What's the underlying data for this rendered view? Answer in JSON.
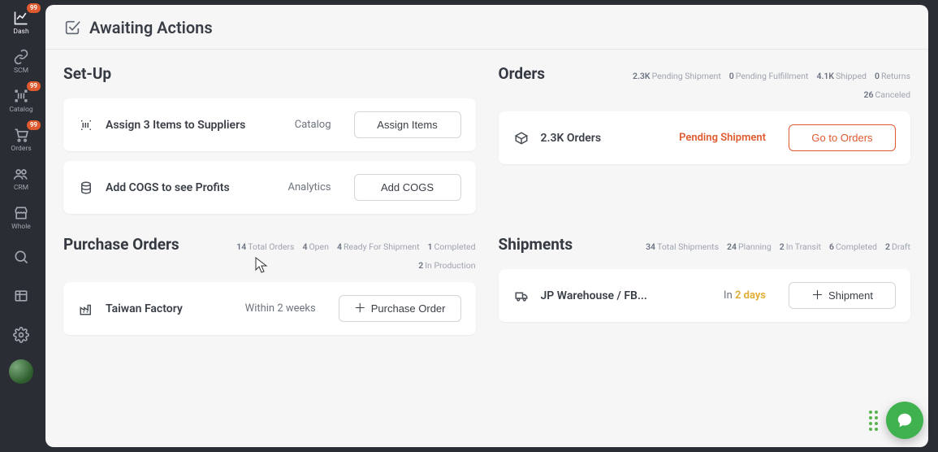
{
  "sidebar": {
    "items": [
      {
        "label": "Dash",
        "badge": "99"
      },
      {
        "label": "SCM",
        "badge": ""
      },
      {
        "label": "Catalog",
        "badge": "99"
      },
      {
        "label": "Orders",
        "badge": "99"
      },
      {
        "label": "CRM",
        "badge": ""
      },
      {
        "label": "Whole",
        "badge": ""
      }
    ]
  },
  "header": {
    "title": "Awaiting Actions"
  },
  "setup": {
    "title": "Set-Up",
    "cards": [
      {
        "title": "Assign 3 Items to Suppliers",
        "sub": "Catalog",
        "btn": "Assign Items"
      },
      {
        "title": "Add COGS to see Profits",
        "sub": "Analytics",
        "btn": "Add COGS"
      }
    ]
  },
  "orders": {
    "title": "Orders",
    "stats": [
      {
        "num": "2.3K",
        "label": "Pending Shipment"
      },
      {
        "num": "0",
        "label": "Pending Fulfillment"
      },
      {
        "num": "4.1K",
        "label": "Shipped"
      },
      {
        "num": "0",
        "label": "Returns"
      },
      {
        "num": "26",
        "label": "Canceled"
      }
    ],
    "card": {
      "title": "2.3K Orders",
      "status": "Pending Shipment",
      "btn": "Go to Orders"
    }
  },
  "po": {
    "title": "Purchase Orders",
    "stats": [
      {
        "num": "14",
        "label": "Total Orders"
      },
      {
        "num": "4",
        "label": "Open"
      },
      {
        "num": "4",
        "label": "Ready For Shipment"
      },
      {
        "num": "1",
        "label": "Completed"
      },
      {
        "num": "2",
        "label": "In Production"
      }
    ],
    "card": {
      "title": "Taiwan Factory",
      "sub": "Within 2 weeks",
      "btn": "Purchase Order"
    }
  },
  "shipments": {
    "title": "Shipments",
    "stats": [
      {
        "num": "34",
        "label": "Total Shipments"
      },
      {
        "num": "24",
        "label": "Planning"
      },
      {
        "num": "2",
        "label": "In Transit"
      },
      {
        "num": "6",
        "label": "Completed"
      },
      {
        "num": "2",
        "label": "Draft"
      }
    ],
    "card": {
      "title": "JP Warehouse / FB...",
      "prefix": "In ",
      "accent": "2 days",
      "btn": "Shipment"
    }
  }
}
